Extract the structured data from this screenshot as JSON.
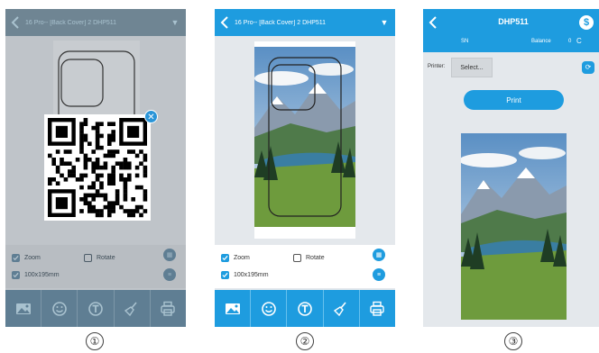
{
  "screen1": {
    "header": {
      "title": "16 Pro-- [Back Cover] 2   DHP511",
      "caret": "▼"
    },
    "qr_close": "✕",
    "options": {
      "zoom": "Zoom",
      "rotate": "Rotate",
      "size": "100x195mm"
    }
  },
  "screen2": {
    "header": {
      "title": "16 Pro-- [Back Cover] 2   DHP511",
      "caret": "▼"
    },
    "options": {
      "zoom": "Zoom",
      "rotate": "Rotate",
      "size": "100x195mm"
    },
    "tools": [
      "image-icon",
      "emoji-icon",
      "text-icon",
      "clear-icon",
      "print-icon"
    ]
  },
  "screen3": {
    "header": {
      "title": "DHP511",
      "sn_label": "SN",
      "balance_label": "Balance",
      "balance_value": "0",
      "refresh_glyph": "C"
    },
    "printer_label": "Printer:",
    "printer_select": "Select...",
    "print_button": "Print"
  },
  "step_labels": [
    "①",
    "②",
    "③"
  ],
  "colors": {
    "accent": "#1e9cdf",
    "dimmed_header": "#6f8593",
    "dimmed_bg": "#bfc4c9",
    "panel_bg": "#e4e8ec"
  }
}
